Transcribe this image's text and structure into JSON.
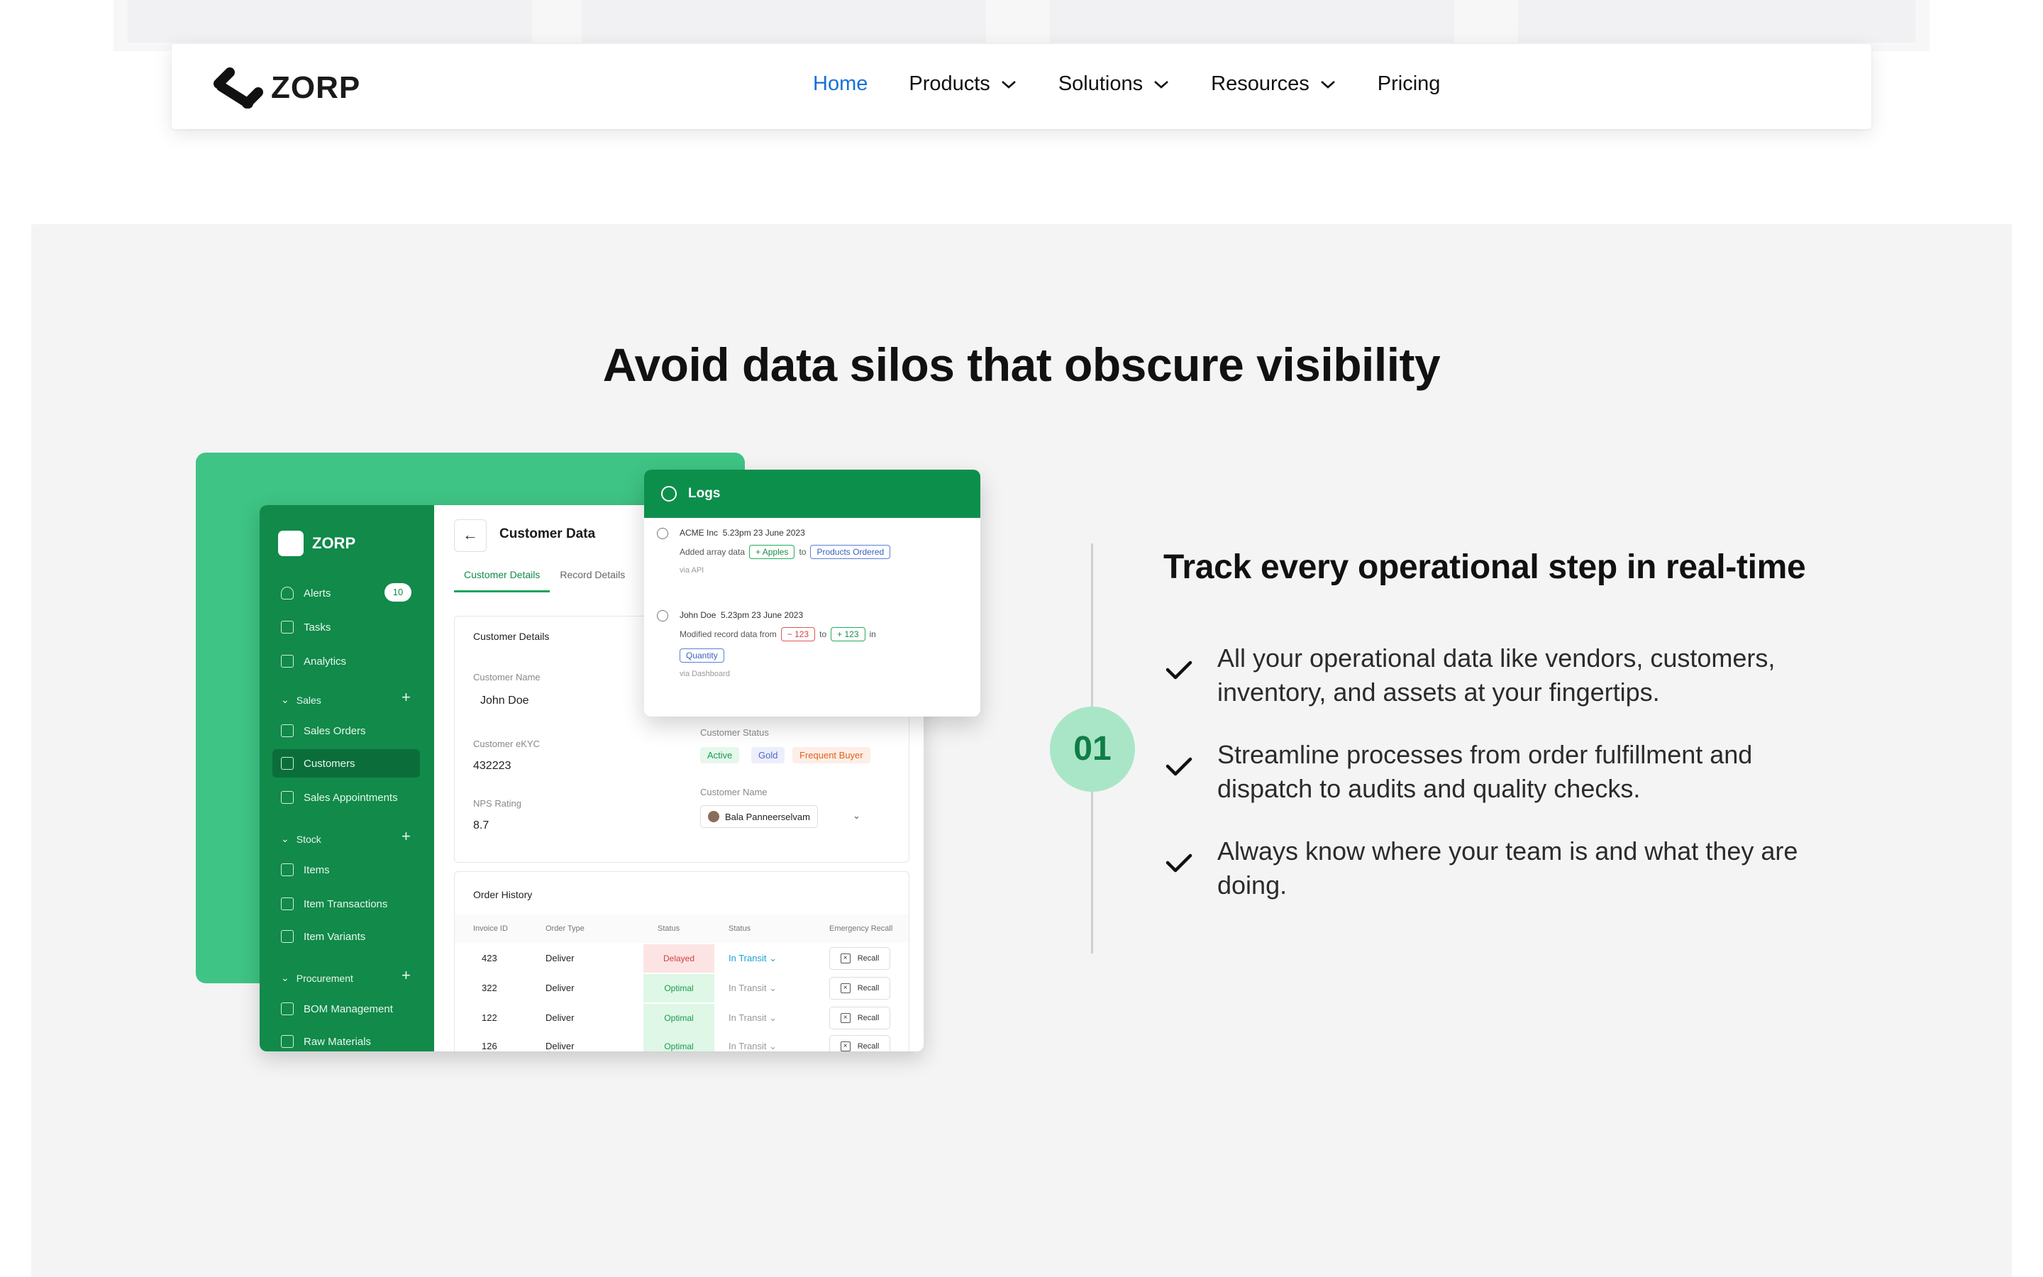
{
  "navbar": {
    "brand": "ZORP",
    "links": [
      {
        "label": "Home",
        "active": true
      },
      {
        "label": "Products",
        "dropdown": true
      },
      {
        "label": "Solutions",
        "dropdown": true
      },
      {
        "label": "Resources",
        "dropdown": true
      },
      {
        "label": "Pricing"
      }
    ]
  },
  "section": {
    "headline": "Avoid data silos that obscure visibility",
    "step": {
      "number": "01",
      "title": "Track every operational step in real-time",
      "bullets": [
        "All your operational data like vendors, customers, inventory, and assets at your fingertips.",
        "Streamline processes from order fulfillment and dispatch to audits and quality checks.",
        "Always know where your team is and what they are doing."
      ]
    }
  },
  "mock_app": {
    "brand": "ZORP",
    "sidebar": {
      "alerts": "Alerts",
      "alerts_count": "10",
      "tasks": "Tasks",
      "analytics": "Analytics",
      "sales_head": "Sales",
      "sales_orders": "Sales Orders",
      "customers": "Customers",
      "sales_appointments": "Sales Appointments",
      "stock_head": "Stock",
      "items": "Items",
      "item_transactions": "Item Transactions",
      "item_variants": "Item Variants",
      "procurement_head": "Procurement",
      "bom_management": "BOM Management",
      "raw_materials": "Raw Materials"
    },
    "main": {
      "title": "Customer Data",
      "tab_customer": "Customer Details",
      "tab_record": "Record Details",
      "card_title": "Customer Details",
      "customer_name_label": "Customer Name",
      "customer_name_value": "John Doe",
      "ekyc_label": "Customer eKYC",
      "ekyc_value": "432223",
      "nps_label": "NPS Rating",
      "nps_value": "8.7",
      "status_label": "Customer Status",
      "status_active": "Active",
      "status_gold": "Gold",
      "status_frequent": "Frequent Buyer",
      "name2_label": "Customer Name",
      "name2_value": "Bala Panneerselvam",
      "order_history": "Order History",
      "headers": {
        "invoice": "Invoice ID",
        "type": "Order Type",
        "status": "Status",
        "status2": "Status",
        "recall": "Emergency Recall"
      },
      "rows": [
        {
          "invoice": "423",
          "type": "Deliver",
          "status": "Delayed",
          "transit": "In Transit",
          "recall": "Recall"
        },
        {
          "invoice": "322",
          "type": "Deliver",
          "status": "Optimal",
          "transit": "In Transit",
          "recall": "Recall"
        },
        {
          "invoice": "122",
          "type": "Deliver",
          "status": "Optimal",
          "transit": "In Transit",
          "recall": "Recall"
        },
        {
          "invoice": "126",
          "type": "Deliver",
          "status": "Optimal",
          "transit": "In Transit",
          "recall": "Recall"
        }
      ]
    },
    "logs": {
      "title": "Logs",
      "entry1_who": "ACME Inc",
      "entry1_time": "5.23pm 23 June 2023",
      "entry1_action": "Added array data",
      "entry1_tag1": "+ Apples",
      "entry1_to": "to",
      "entry1_tag2": "Products Ordered",
      "entry1_via": "via API",
      "entry2_who": "John Doe",
      "entry2_time": "5.23pm 23 June 2023",
      "entry2_action": "Modified record data from",
      "entry2_tag1": "− 123",
      "entry2_to": "to",
      "entry2_tag2": "+ 123",
      "entry2_in": "in",
      "entry2_tag3": "Quantity",
      "entry2_via": "via Dashboard"
    }
  },
  "colors": {
    "accent_link": "#1671d6",
    "brand_green": "#118a4a",
    "panel_green": "#3ec484",
    "step_circle": "#a9e6c7"
  }
}
